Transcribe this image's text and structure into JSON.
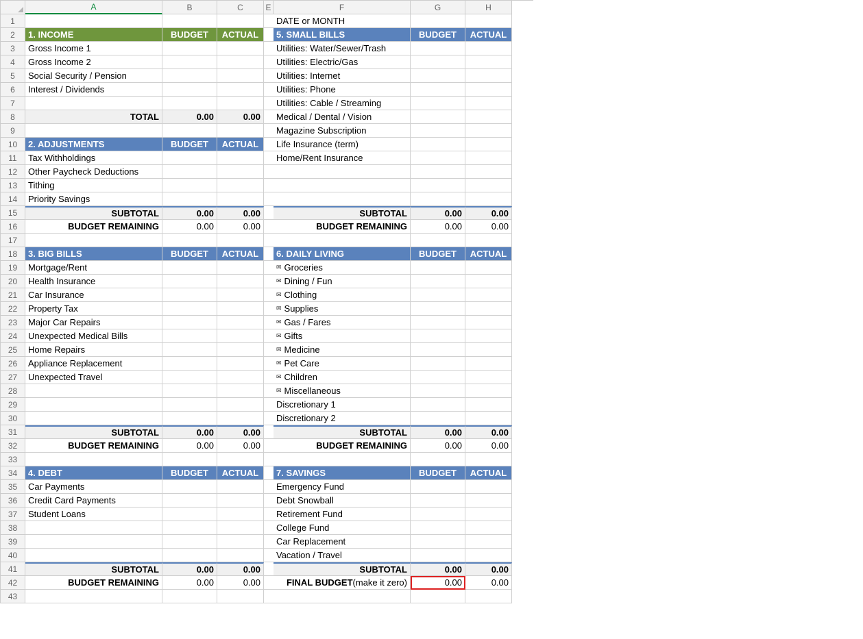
{
  "cols": [
    "A",
    "B",
    "C",
    "E",
    "F",
    "G",
    "H"
  ],
  "rows": [
    "1",
    "2",
    "3",
    "4",
    "5",
    "6",
    "7",
    "8",
    "9",
    "10",
    "11",
    "12",
    "13",
    "14",
    "15",
    "16",
    "17",
    "18",
    "19",
    "20",
    "21",
    "22",
    "23",
    "24",
    "25",
    "26",
    "27",
    "28",
    "29",
    "30",
    "31",
    "32",
    "33",
    "34",
    "35",
    "36",
    "37",
    "38",
    "39",
    "40",
    "41",
    "42",
    "43"
  ],
  "labels": {
    "budget": "BUDGET",
    "actual": "ACTUAL",
    "total": "TOTAL",
    "subtotal": "SUBTOTAL",
    "budget_remaining": "BUDGET REMAINING",
    "date_month": "DATE  or MONTH",
    "final_budget": "FINAL BUDGET",
    "make_it_zero": " (make it zero)"
  },
  "sec1": {
    "title": "1. INCOME",
    "items": [
      "Gross Income 1",
      "Gross Income 2",
      "Social Security / Pension",
      "Interest / Dividends",
      ""
    ],
    "total_b": "0.00",
    "total_a": "0.00"
  },
  "sec2": {
    "title": "2. ADJUSTMENTS",
    "items": [
      "Tax Withholdings",
      "Other Paycheck Deductions",
      "Tithing",
      "Priority Savings"
    ],
    "sub_b": "0.00",
    "sub_a": "0.00",
    "rem_b": "0.00",
    "rem_a": "0.00"
  },
  "sec3": {
    "title": "3. BIG BILLS",
    "items": [
      "Mortgage/Rent",
      "Health Insurance",
      "Car Insurance",
      "Property Tax",
      "Major Car Repairs",
      "Unexpected Medical Bills",
      "Home Repairs",
      "Appliance Replacement",
      "Unexpected Travel",
      "",
      "",
      ""
    ],
    "sub_b": "0.00",
    "sub_a": "0.00",
    "rem_b": "0.00",
    "rem_a": "0.00"
  },
  "sec4": {
    "title": "4. DEBT",
    "items": [
      "Car Payments",
      "Credit Card Payments",
      "Student Loans",
      "",
      "",
      ""
    ],
    "sub_b": "0.00",
    "sub_a": "0.00",
    "rem_b": "0.00",
    "rem_a": "0.00"
  },
  "sec5": {
    "title": "5. SMALL BILLS",
    "items": [
      "Utilities: Water/Sewer/Trash",
      "Utilities: Electric/Gas",
      "Utilities: Internet",
      "Utilities: Phone",
      "Utilities: Cable / Streaming",
      "Medical / Dental / Vision",
      "Magazine Subscription",
      "Life Insurance (term)",
      "Home/Rent Insurance",
      "",
      "",
      ""
    ],
    "sub_b": "0.00",
    "sub_a": "0.00",
    "rem_b": "0.00",
    "rem_a": "0.00"
  },
  "sec6": {
    "title": "6. DAILY LIVING",
    "items": [
      "Groceries",
      "Dining / Fun",
      "Clothing",
      "Supplies",
      "Gas / Fares",
      "Gifts",
      "Medicine",
      "Pet Care",
      "Children",
      "Miscellaneous",
      "Discretionary 1",
      "Discretionary 2"
    ],
    "icon_rows": [
      0,
      1,
      2,
      3,
      4,
      5,
      6,
      7,
      8,
      9
    ],
    "sub_b": "0.00",
    "sub_a": "0.00",
    "rem_b": "0.00",
    "rem_a": "0.00"
  },
  "sec7": {
    "title": "7. SAVINGS",
    "items": [
      "Emergency Fund",
      "Debt Snowball",
      "Retirement Fund",
      "College Fund",
      "Car Replacement",
      "Vacation / Travel"
    ],
    "sub_b": "0.00",
    "sub_a": "0.00",
    "final_b": "0.00",
    "final_a": "0.00"
  }
}
